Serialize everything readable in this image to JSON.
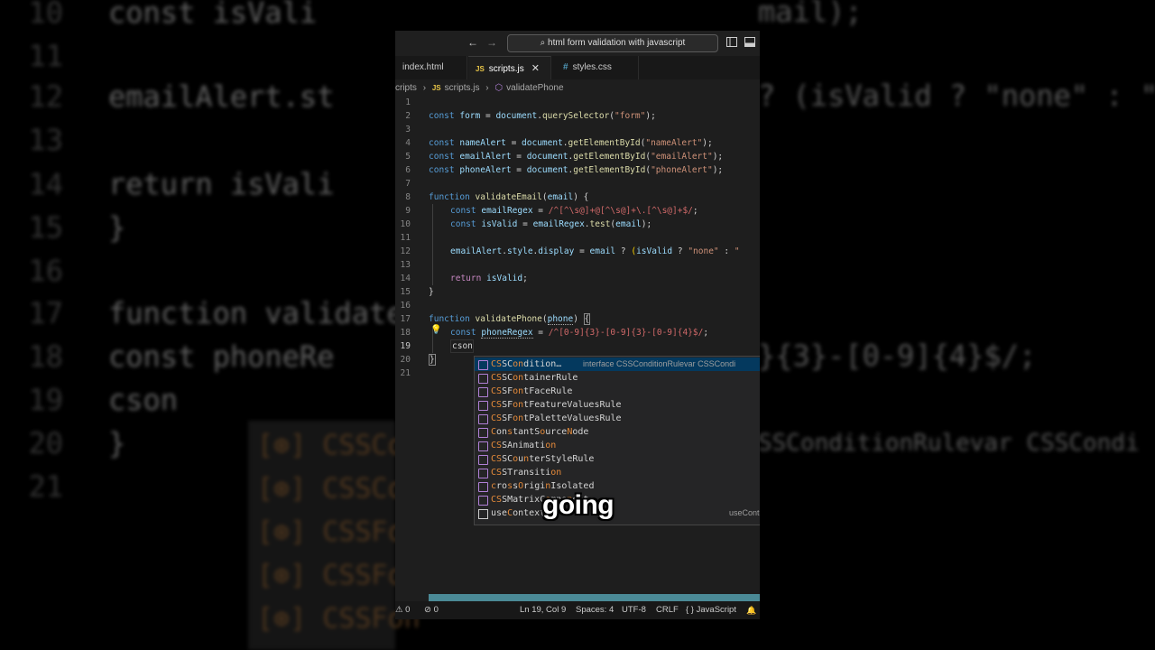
{
  "window": {
    "search_text": "html form validation with javascript",
    "back_icon": "←",
    "forward_icon": "→",
    "search_icon": "⌕"
  },
  "tabs": [
    {
      "label": "index.html",
      "kind": "html"
    },
    {
      "label": "scripts.js",
      "kind": "js",
      "badge": "JS",
      "active": true,
      "close": "✕"
    },
    {
      "label": "styles.css",
      "kind": "css",
      "badge": "#"
    }
  ],
  "breadcrumb": {
    "folder": "cripts",
    "sep1": "›",
    "file_badge": "JS",
    "file": "scripts.js",
    "sep2": "›",
    "symbol": "validatePhone"
  },
  "code": {
    "line_numbers": [
      "1",
      "2",
      "3",
      "4",
      "5",
      "6",
      "7",
      "8",
      "9",
      "10",
      "11",
      "12",
      "13",
      "14",
      "15",
      "16",
      "17",
      "18",
      "19",
      "20",
      "21"
    ],
    "current_line": 19,
    "lines": {
      "l2": [
        "const",
        "form",
        "=",
        "document",
        ".",
        "querySelector",
        "(",
        "\"form\"",
        ");"
      ],
      "l4": [
        "const",
        "nameAlert",
        "=",
        "document",
        ".",
        "getElementById",
        "(",
        "\"nameAlert\"",
        ");"
      ],
      "l5": [
        "const",
        "emailAlert",
        "=",
        "document",
        ".",
        "getElementById",
        "(",
        "\"emailAlert\"",
        ");"
      ],
      "l6": [
        "const",
        "phoneAlert",
        "=",
        "document",
        ".",
        "getElementById",
        "(",
        "\"phoneAlert\"",
        ");"
      ],
      "l8": [
        "function",
        "validateEmail",
        "(",
        "email",
        ") {"
      ],
      "l9": [
        "const",
        "emailRegex",
        "=",
        "/^[^\\s@]+@[^\\s@]+\\.[^\\s@]+$/",
        ";"
      ],
      "l10": [
        "const",
        "isValid",
        "=",
        "emailRegex",
        ".",
        "test",
        "(",
        "email",
        ");"
      ],
      "l12": [
        "emailAlert",
        ".",
        "style",
        ".",
        "display",
        "=",
        "email",
        "?",
        "(",
        "isValid",
        "?",
        "\"none\"",
        ":",
        "\""
      ],
      "l14": [
        "return",
        "isValid",
        ";"
      ],
      "l15": [
        "}"
      ],
      "l17": [
        "function",
        "validatePhone",
        "(",
        "phone",
        ")",
        "{"
      ],
      "l18": [
        "const",
        "phoneRegex",
        "=",
        "/^[0-9]{3}-[0-9]{3}-[0-9]{4}$/",
        ";"
      ],
      "l19": [
        "cson"
      ],
      "l20": [
        "}"
      ]
    }
  },
  "suggestions": [
    {
      "label": "CSSCondition…",
      "parts": [
        [
          "CS",
          ""
        ],
        [
          "S",
          "m"
        ],
        [
          "C",
          "m"
        ],
        [
          "ondition…",
          ""
        ]
      ],
      "detail": "interface CSSConditionRulevar CSSCondi",
      "selected": true
    },
    {
      "label": "CSSContainerRule",
      "detail": ""
    },
    {
      "label": "CSSFontFaceRule",
      "detail": ""
    },
    {
      "label": "CSSFontFeatureValuesRule",
      "detail": ""
    },
    {
      "label": "CSSFontPaletteValuesRule",
      "detail": ""
    },
    {
      "label": "ConstantSourceNode",
      "detail": ""
    },
    {
      "label": "CSSAnimation",
      "detail": ""
    },
    {
      "label": "CSSCounterStyleRule",
      "detail": ""
    },
    {
      "label": "CSSTransition",
      "detail": ""
    },
    {
      "label": "crossOriginIsolated",
      "detail": ""
    },
    {
      "label": "CSSMatrixComponent",
      "detail": ""
    },
    {
      "label": "useContext",
      "detail": "useConte",
      "box": true
    }
  ],
  "caption": "going",
  "status": {
    "errors": "⚠ 0",
    "warnings": "⊘ 0",
    "position": "Ln 19, Col 9",
    "spaces": "Spaces: 4",
    "encoding": "UTF-8",
    "eol": "CRLF",
    "language": "{ } JavaScript",
    "bell": "🔔"
  },
  "backdrop": {
    "lines": [
      {
        "n": "10",
        "code": "const isVali"
      },
      {
        "n": "11",
        "code": ""
      },
      {
        "n": "12",
        "code": "emailAlert.st"
      },
      {
        "n": "13",
        "code": ""
      },
      {
        "n": "14",
        "code": "return isVali"
      },
      {
        "n": "15",
        "code": "}"
      },
      {
        "n": "16",
        "code": ""
      },
      {
        "n": "17",
        "code": "function validate"
      },
      {
        "n": "18",
        "code": "const phoneRe"
      },
      {
        "n": "19",
        "code": "cson"
      },
      {
        "n": "20",
        "code": "}"
      },
      {
        "n": "21",
        "code": ""
      }
    ],
    "right": [
      "mail);",
      "? (isValid ? \"none\" : \"",
      "}{3}-[0-9]{4}$/;",
      "SSConditionRulevar CSSCondi"
    ],
    "suggest": [
      "[⊛] CSSCon",
      "[⊛] CSSCon",
      "[⊛] CSSFon",
      "[⊛] CSSFon",
      "[⊛] CSSFon"
    ]
  }
}
